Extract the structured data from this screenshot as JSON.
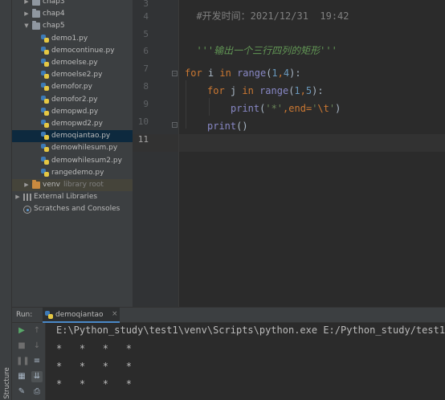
{
  "project_tree": [
    {
      "label": "chap3",
      "type": "folder",
      "expanded": false,
      "indent": 1
    },
    {
      "label": "chap4",
      "type": "folder",
      "expanded": false,
      "indent": 1
    },
    {
      "label": "chap5",
      "type": "folder",
      "expanded": true,
      "indent": 1
    },
    {
      "label": "demo1.py",
      "type": "py",
      "indent": 2
    },
    {
      "label": "democontinue.py",
      "type": "py",
      "indent": 2
    },
    {
      "label": "demoelse.py",
      "type": "py",
      "indent": 2
    },
    {
      "label": "demoelse2.py",
      "type": "py",
      "indent": 2
    },
    {
      "label": "demofor.py",
      "type": "py",
      "indent": 2
    },
    {
      "label": "demofor2.py",
      "type": "py",
      "indent": 2
    },
    {
      "label": "demopwd.py",
      "type": "py",
      "indent": 2
    },
    {
      "label": "demopwd2.py",
      "type": "py",
      "indent": 2
    },
    {
      "label": "demoqiantao.py",
      "type": "py",
      "indent": 2,
      "selected": true
    },
    {
      "label": "demowhilesum.py",
      "type": "py",
      "indent": 2
    },
    {
      "label": "demowhilesum2.py",
      "type": "py",
      "indent": 2
    },
    {
      "label": "rangedemo.py",
      "type": "py",
      "indent": 2
    },
    {
      "label": "venv",
      "sublabel": "library root",
      "type": "folder-orange",
      "expanded": false,
      "indent": 1,
      "excluded": true
    },
    {
      "label": "External Libraries",
      "type": "lib",
      "expanded": false,
      "indent": 0
    },
    {
      "label": "Scratches and Consoles",
      "type": "scratch",
      "indent": 0
    }
  ],
  "editor": {
    "line_numbers": [
      "3",
      "4",
      "5",
      "6",
      "7",
      "8",
      "9",
      "10",
      "11"
    ],
    "current_line": "11",
    "lines": {
      "l3": "#开发时间：2021/12/31  19:42",
      "l5": "'''输出一个三行四列的矩形'''",
      "l7_kw": "for",
      "l7_a": " i ",
      "l7_in": "in",
      "l7_sp": " ",
      "l7_range": "range",
      "l7_open": "(",
      "l7_n1": "1",
      "l7_comma": ",",
      "l7_n2": "4",
      "l7_close": "):",
      "l8_kw": "for",
      "l8_a": " j ",
      "l8_in": "in",
      "l8_sp": " ",
      "l8_range": "range",
      "l8_open": "(",
      "l8_n1": "1",
      "l8_comma": ",",
      "l8_n2": "5",
      "l8_close": "):",
      "l9_print": "print",
      "l9_open": "(",
      "l9_str": "'*'",
      "l9_comma": ",",
      "l9_kwarg": "end=",
      "l9_q1": "'",
      "l9_esc": "\\t",
      "l9_q2": "'",
      "l9_close": ")",
      "l10_print": "print",
      "l10_paren": "()"
    }
  },
  "run_panel": {
    "label": "Run:",
    "tab_label": "demoqiantao",
    "tab_close": "×",
    "output": [
      "E:\\Python_study\\test1\\venv\\Scripts\\python.exe E:/Python_study/test1",
      "*   *   *   *",
      "*   *   *   *",
      "*   *   *   *"
    ]
  },
  "sidebar": {
    "structure_label": "Structure"
  },
  "colors": {
    "background": "#2b2b2b",
    "panel": "#3c3f41",
    "selection": "#0d293e",
    "keyword": "#cc7832",
    "string": "#6a8759",
    "number": "#6897bb",
    "builtin": "#8888c6"
  }
}
